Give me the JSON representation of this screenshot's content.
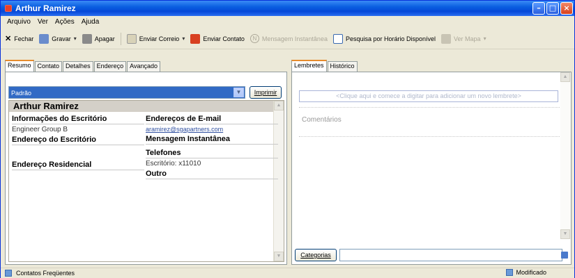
{
  "window": {
    "title": "Arthur Ramirez"
  },
  "menu": [
    "Arquivo",
    "Ver",
    "Ações",
    "Ajuda"
  ],
  "toolbar": {
    "close_label": "Fechar",
    "save_label": "Gravar",
    "delete_label": "Apagar",
    "send_mail_label": "Enviar Correio",
    "send_contact_label": "Enviar Contato",
    "instant_message_label": "Mensagem Instantânea",
    "schedule_search_label": "Pesquisa por Horário Disponível",
    "view_map_label": "Ver Mapa"
  },
  "left_tabs": [
    "Resumo",
    "Contato",
    "Detalhes",
    "Endereço",
    "Avançado"
  ],
  "view_select": {
    "value": "Padrão"
  },
  "print_label": "Imprimir",
  "card": {
    "name": "Arthur Ramirez",
    "office_info_title": "Informações do Escritório",
    "company": "Engineer Group B",
    "office_address_title": "Endereço do Escritório",
    "home_address_title": "Endereço Residencial",
    "email_title": "Endereços de E-mail",
    "email": "aramirez@sgapartners.com",
    "im_title": "Mensagem Instantânea",
    "phones_title": "Telefones",
    "office_phone": "Escritório: x11010",
    "other_title": "Outro"
  },
  "right_tabs": [
    "Lembretes",
    "Histórico"
  ],
  "reminder_placeholder": "<Clique aqui e comece a digitar para adicionar um novo lembrete>",
  "comments_label": "Comentários",
  "categories_label": "Categorias",
  "status": {
    "left": "Contatos Freqüentes",
    "right": "Modificado"
  },
  "colors": {
    "titlebar": "#0a5fe0",
    "selection": "#316ac5",
    "tab_accent": "#e68b2c"
  }
}
